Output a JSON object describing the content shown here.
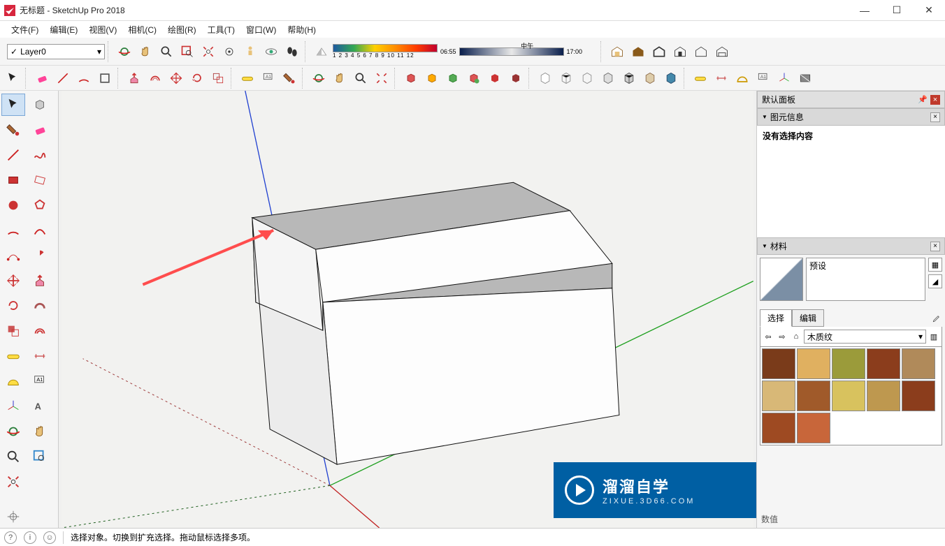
{
  "window": {
    "title": "无标题 - SketchUp Pro 2018",
    "min": "—",
    "max": "☐",
    "close": "✕"
  },
  "menu": {
    "file": "文件(F)",
    "edit": "编辑(E)",
    "view": "视图(V)",
    "camera": "相机(C)",
    "draw": "绘图(R)",
    "tools": "工具(T)",
    "window": "窗口(W)",
    "help": "帮助(H)"
  },
  "layer": {
    "check": "✓",
    "current": "Layer0"
  },
  "shadow": {
    "ticks": "1  2  3  4  5  6  7  8  9  10 11 12",
    "time_left": "06:55",
    "time_mid": "中午",
    "time_right": "17:00"
  },
  "panels": {
    "tray_title": "默认面板",
    "entity": {
      "title": "图元信息",
      "empty": "没有选择内容"
    },
    "materials": {
      "title": "材料",
      "preset": "预设",
      "tab_select": "选择",
      "tab_edit": "编辑",
      "category": "木质纹"
    },
    "value_label": "数值"
  },
  "status": {
    "hint": "选择对象。切换到扩充选择。拖动鼠标选择多项。"
  },
  "watermark": {
    "line1": "溜溜自学",
    "line2": "ZIXUE.3D66.COM"
  },
  "wood_colors": [
    "#7a3b1a",
    "#e0b060",
    "#9b9b3a",
    "#8b3d1c",
    "#b08a5a",
    "#d8b877",
    "#a05a2a",
    "#d8c25e",
    "#be984f",
    "#8b3d1c",
    "#9e4a22",
    "#c8663a"
  ]
}
